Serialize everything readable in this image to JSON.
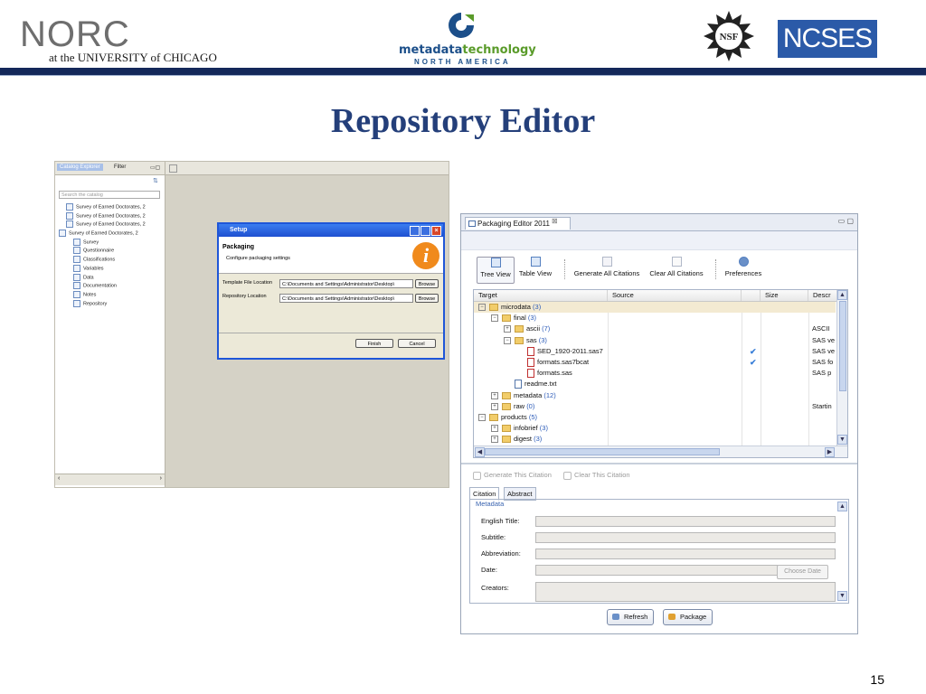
{
  "logos": {
    "norc_word": "NORC",
    "norc_subtitle": "at the UNIVERSITY of CHICAGO",
    "metadata_word1": "metadata",
    "metadata_word2": "technology",
    "metadata_sub": "NORTH AMERICA",
    "nsf": "NSF",
    "ncses": "NCSES"
  },
  "slide": {
    "title": "Repository Editor",
    "page_number": "15"
  },
  "catalog": {
    "tabs": [
      "Catalog Explorer",
      "Filter"
    ],
    "search_placeholder": "Search the catalog",
    "tree": [
      {
        "label": "Survey of Earned Doctorates, 2",
        "indent": 1
      },
      {
        "label": "Survey of Earned Doctorates, 2",
        "indent": 1
      },
      {
        "label": "Survey of Earned Doctorates, 2",
        "indent": 1
      },
      {
        "label": "Survey of Earned Doctorates, 2",
        "indent": 0
      },
      {
        "label": "Survey",
        "indent": 2
      },
      {
        "label": "Questionnaire",
        "indent": 2
      },
      {
        "label": "Classifications",
        "indent": 2
      },
      {
        "label": "Variables",
        "indent": 2
      },
      {
        "label": "Data",
        "indent": 2
      },
      {
        "label": "Documentation",
        "indent": 2
      },
      {
        "label": "Notes",
        "indent": 2
      },
      {
        "label": "Repository",
        "indent": 2
      }
    ]
  },
  "setup_dialog": {
    "title": "Setup",
    "heading": "Packaging",
    "subheading": "Configure packaging settings",
    "info_icon": "i",
    "fields": [
      {
        "label": "Template File Location",
        "value": "C:\\Documents and Settings\\Administrator\\Desktop\\",
        "button": "Browse"
      },
      {
        "label": "Repository Location",
        "value": "C:\\Documents and Settings\\Administrator\\Desktop\\",
        "button": "Browse"
      }
    ],
    "finish": "Finish",
    "cancel": "Cancel"
  },
  "packaging_editor": {
    "tab_title": "Packaging Editor 2011",
    "close_glyph": "⊠",
    "minmax_glyph": "▭ ▢",
    "toolbar": {
      "tree_view": "Tree View",
      "table_view": "Table View",
      "generate_all": "Generate All Citations",
      "clear_all": "Clear All Citations",
      "preferences": "Preferences"
    },
    "columns": [
      "Target",
      "Source",
      "",
      "Size",
      "Descr"
    ],
    "rows": [
      {
        "name": "microdata",
        "count": "(3)",
        "kind": "folder",
        "exp": "−",
        "depth": 0,
        "desc": "",
        "check": false,
        "selected": true
      },
      {
        "name": "final",
        "count": "(3)",
        "kind": "folder",
        "exp": "−",
        "depth": 1,
        "desc": "",
        "check": false,
        "selected": false
      },
      {
        "name": "ascii",
        "count": "(7)",
        "kind": "folder",
        "exp": "+",
        "depth": 2,
        "desc": "ASCII",
        "check": false,
        "selected": false
      },
      {
        "name": "sas",
        "count": "(3)",
        "kind": "folder",
        "exp": "−",
        "depth": 2,
        "desc": "SAS ve",
        "check": false,
        "selected": false
      },
      {
        "name": "SED_1920-2011.sas7",
        "count": "",
        "kind": "file",
        "exp": "",
        "depth": 3,
        "desc": "SAS ve",
        "check": true,
        "selected": false
      },
      {
        "name": "formats.sas7bcat",
        "count": "",
        "kind": "file",
        "exp": "",
        "depth": 3,
        "desc": "SAS fo",
        "check": true,
        "selected": false
      },
      {
        "name": "formats.sas",
        "count": "",
        "kind": "file",
        "exp": "",
        "depth": 3,
        "desc": "SAS p",
        "check": false,
        "selected": false
      },
      {
        "name": "readme.txt",
        "count": "",
        "kind": "txt",
        "exp": "",
        "depth": 2,
        "desc": "",
        "check": false,
        "selected": false
      },
      {
        "name": "metadata",
        "count": "(12)",
        "kind": "folder",
        "exp": "+",
        "depth": 1,
        "desc": "",
        "check": false,
        "selected": false
      },
      {
        "name": "raw",
        "count": "(0)",
        "kind": "folder",
        "exp": "+",
        "depth": 1,
        "desc": "Startin",
        "check": false,
        "selected": false
      },
      {
        "name": "products",
        "count": "(5)",
        "kind": "folder",
        "exp": "−",
        "depth": 0,
        "desc": "",
        "check": false,
        "selected": false
      },
      {
        "name": "infobrief",
        "count": "(3)",
        "kind": "folder",
        "exp": "+",
        "depth": 1,
        "desc": "",
        "check": false,
        "selected": false
      },
      {
        "name": "digest",
        "count": "(3)",
        "kind": "folder",
        "exp": "+",
        "depth": 1,
        "desc": "",
        "check": false,
        "selected": false
      }
    ],
    "generate_this": "Generate This Citation",
    "clear_this": "Clear This Citation",
    "citation_tabs": [
      "Citation",
      "Abstract"
    ],
    "metadata_label": "Metadata",
    "form_fields": [
      "English Title:",
      "Subtitle:",
      "Abbreviation:",
      "Date:",
      "Creators:"
    ],
    "choose_date": "Choose Date",
    "refresh": "Refresh",
    "package": "Package"
  }
}
